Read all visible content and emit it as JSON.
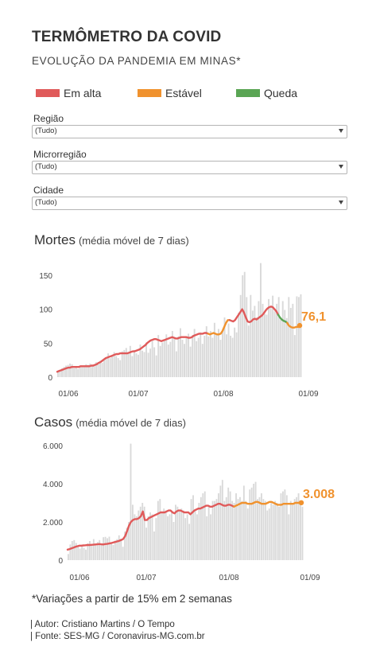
{
  "header": {
    "title": "TERMÔMETRO DA COVID",
    "subtitle": "EVOLUÇÃO DA PANDEMIA EM MINAS*"
  },
  "legend": [
    {
      "label": "Em alta",
      "color": "#e05a5a"
    },
    {
      "label": "Estável",
      "color": "#f0922e"
    },
    {
      "label": "Queda",
      "color": "#5aa554"
    }
  ],
  "filters": [
    {
      "label": "Região",
      "value": "(Tudo)"
    },
    {
      "label": "Microrregião",
      "value": "(Tudo)"
    },
    {
      "label": "Cidade",
      "value": "(Tudo)"
    }
  ],
  "colors": {
    "rising": "#e05a5a",
    "stable": "#f0922e",
    "falling": "#5aa554",
    "bars": "#d9d9d9",
    "highlight": "#f0922e"
  },
  "chart_data": [
    {
      "type": "bar",
      "title": "Mortes",
      "subtitle": "(média móvel de 7 dias)",
      "x_ticks": [
        "01/06",
        "01/07",
        "01/08",
        "01/09"
      ],
      "y_ticks": [
        "0",
        "50",
        "100",
        "150"
      ],
      "ylim": [
        0,
        175
      ],
      "grid": false,
      "last_value_label": "76,1",
      "daily_values": [
        9,
        11,
        13,
        15,
        17,
        18,
        20,
        19,
        13,
        15,
        12,
        16,
        17,
        15,
        19,
        18,
        20,
        16,
        17,
        22,
        19,
        24,
        21,
        25,
        27,
        35,
        28,
        32,
        37,
        31,
        28,
        25,
        38,
        40,
        43,
        37,
        46,
        31,
        40,
        35,
        33,
        48,
        39,
        37,
        51,
        36,
        42,
        53,
        44,
        32,
        62,
        46,
        51,
        55,
        63,
        48,
        52,
        68,
        57,
        38,
        60,
        72,
        55,
        49,
        58,
        64,
        45,
        62,
        71,
        53,
        58,
        66,
        49,
        61,
        75,
        60,
        68,
        58,
        80,
        64,
        71,
        55,
        69,
        88,
        63,
        79,
        61,
        58,
        73,
        66,
        95,
        121,
        150,
        155,
        118,
        76,
        121,
        98,
        105,
        88,
        112,
        168,
        108,
        93,
        92,
        115,
        103,
        120,
        97,
        108,
        118,
        85,
        112,
        99,
        87,
        118,
        102,
        108,
        62,
        119,
        118,
        122
      ],
      "series": [
        {
          "name": "Mortes média móvel",
          "segments": [
            {
              "trend": "rising",
              "values": [
                8,
                9,
                10,
                11,
                12,
                13,
                14,
                14,
                15,
                15,
                15,
                15,
                15,
                16,
                16,
                16,
                16,
                16,
                16,
                17,
                17,
                18,
                19,
                21,
                22,
                24,
                26,
                28,
                29,
                30,
                31,
                32,
                33,
                34,
                34,
                35,
                35,
                35,
                35,
                35,
                36,
                37,
                38,
                38,
                39,
                40,
                41,
                43,
                45,
                47,
                50,
                52,
                54,
                55,
                56,
                56,
                55,
                54,
                53,
                54,
                55,
                56,
                57,
                58,
                59,
                58,
                57,
                57,
                58,
                59,
                59,
                59,
                59,
                58,
                58,
                59,
                61,
                62,
                63,
                64,
                64,
                64,
                65,
                65,
                64
              ]
            },
            {
              "trend": "stable",
              "values": [
                64,
                63,
                64,
                65,
                64,
                63,
                63,
                64,
                68,
                74,
                80,
                84,
                84
              ]
            },
            {
              "trend": "rising",
              "values": [
                84,
                83,
                82,
                84,
                88,
                92,
                96,
                100,
                95,
                88,
                82,
                81,
                82,
                85,
                86,
                85,
                87,
                89,
                91,
                94,
                98,
                101,
                103,
                104,
                103,
                100,
                97,
                92
              ]
            },
            {
              "trend": "falling",
              "values": [
                92,
                88,
                85,
                83,
                82,
                80
              ]
            },
            {
              "trend": "stable",
              "values": [
                80,
                76,
                74,
                73,
                73,
                74,
                74,
                76.1
              ]
            }
          ]
        }
      ]
    },
    {
      "type": "bar",
      "title": "Casos",
      "subtitle": "(média móvel de 7 dias)",
      "x_ticks": [
        "01/06",
        "01/07",
        "01/08",
        "01/09"
      ],
      "y_ticks": [
        "0",
        "2.000",
        "4.000",
        "6.000"
      ],
      "ylim": [
        0,
        6000
      ],
      "grid": false,
      "last_value_label": "3.008",
      "daily_values": [
        320,
        820,
        1000,
        1050,
        900,
        770,
        600,
        720,
        640,
        550,
        880,
        1000,
        750,
        1100,
        800,
        950,
        1050,
        860,
        1200,
        1220,
        1150,
        1230,
        900,
        800,
        1020,
        1100,
        1300,
        1130,
        700,
        1500,
        1700,
        2000,
        6100,
        2900,
        2400,
        2300,
        2600,
        2800,
        3000,
        2800,
        1700,
        2300,
        2500,
        2400,
        1500,
        2200,
        3100,
        3200,
        2500,
        2700,
        2600,
        2300,
        2400,
        2500,
        2000,
        2900,
        2800,
        2600,
        2700,
        2600,
        2200,
        2400,
        1900,
        3200,
        3400,
        2600,
        2400,
        3000,
        3300,
        3500,
        3600,
        2300,
        2800,
        2400,
        3100,
        3100,
        3200,
        3500,
        3900,
        4200,
        3100,
        3300,
        3800,
        3600,
        3100,
        3000,
        3500,
        3200,
        3300,
        3100,
        3900,
        3100,
        2700,
        3700,
        3800,
        4000,
        4100,
        3200,
        3300,
        3500,
        3200,
        3100,
        2600,
        2700,
        3000,
        2900,
        3100,
        3000,
        2800,
        3500,
        3600,
        3700,
        3400,
        2400,
        3100,
        2900,
        3200,
        3300,
        3500,
        3100,
        2800
      ],
      "series": [
        {
          "name": "Casos média móvel",
          "segments": [
            {
              "trend": "rising",
              "values": [
                550,
                580,
                620,
                660,
                700,
                730,
                760,
                760,
                770,
                780,
                790,
                790,
                800,
                810,
                820,
                830,
                840,
                830,
                820,
                840,
                850,
                870,
                890,
                920,
                950,
                980,
                1010,
                1050,
                1100,
                1250,
                1500,
                1800,
                2000,
                2100,
                2150,
                2150,
                2200,
                2300,
                2550,
                2100,
                2100,
                2200,
                2250,
                2300,
                2350,
                2400,
                2450,
                2500,
                2500,
                2500,
                2550,
                2600,
                2600,
                2500,
                2450,
                2550,
                2600,
                2600,
                2550,
                2500,
                2500,
                2500,
                2400,
                2500,
                2600,
                2650,
                2700,
                2700,
                2750,
                2800,
                2850,
                2850,
                2800,
                2800,
                2850,
                2900,
                2950,
                2950,
                2900,
                2850,
                2850,
                2900,
                2900,
                2850,
                2800
              ]
            },
            {
              "trend": "stable",
              "values": [
                2800,
                2850,
                2900,
                2950,
                3000,
                3000,
                3000,
                2950,
                2950,
                2950,
                3000,
                3050,
                3050,
                3000,
                2950,
                2950,
                2950,
                3000,
                3050,
                3050,
                3000,
                2950,
                2900,
                2900,
                2900,
                2950,
                2950,
                2950,
                2950,
                2950,
                2950,
                3000,
                3000,
                3000,
                3008
              ]
            }
          ]
        }
      ]
    }
  ],
  "charts_text": {
    "mortes_title": "Mortes",
    "mortes_sub": "(média móvel de 7 dias)",
    "casos_title": "Casos",
    "casos_sub": "(média móvel de 7 dias)"
  },
  "footnote": "*Variações a partir de 15% em 2 semanas",
  "credits": [
    "| Autor: Cristiano Martins / O Tempo",
    "| Fonte: SES-MG / Coronavirus-MG.com.br"
  ]
}
